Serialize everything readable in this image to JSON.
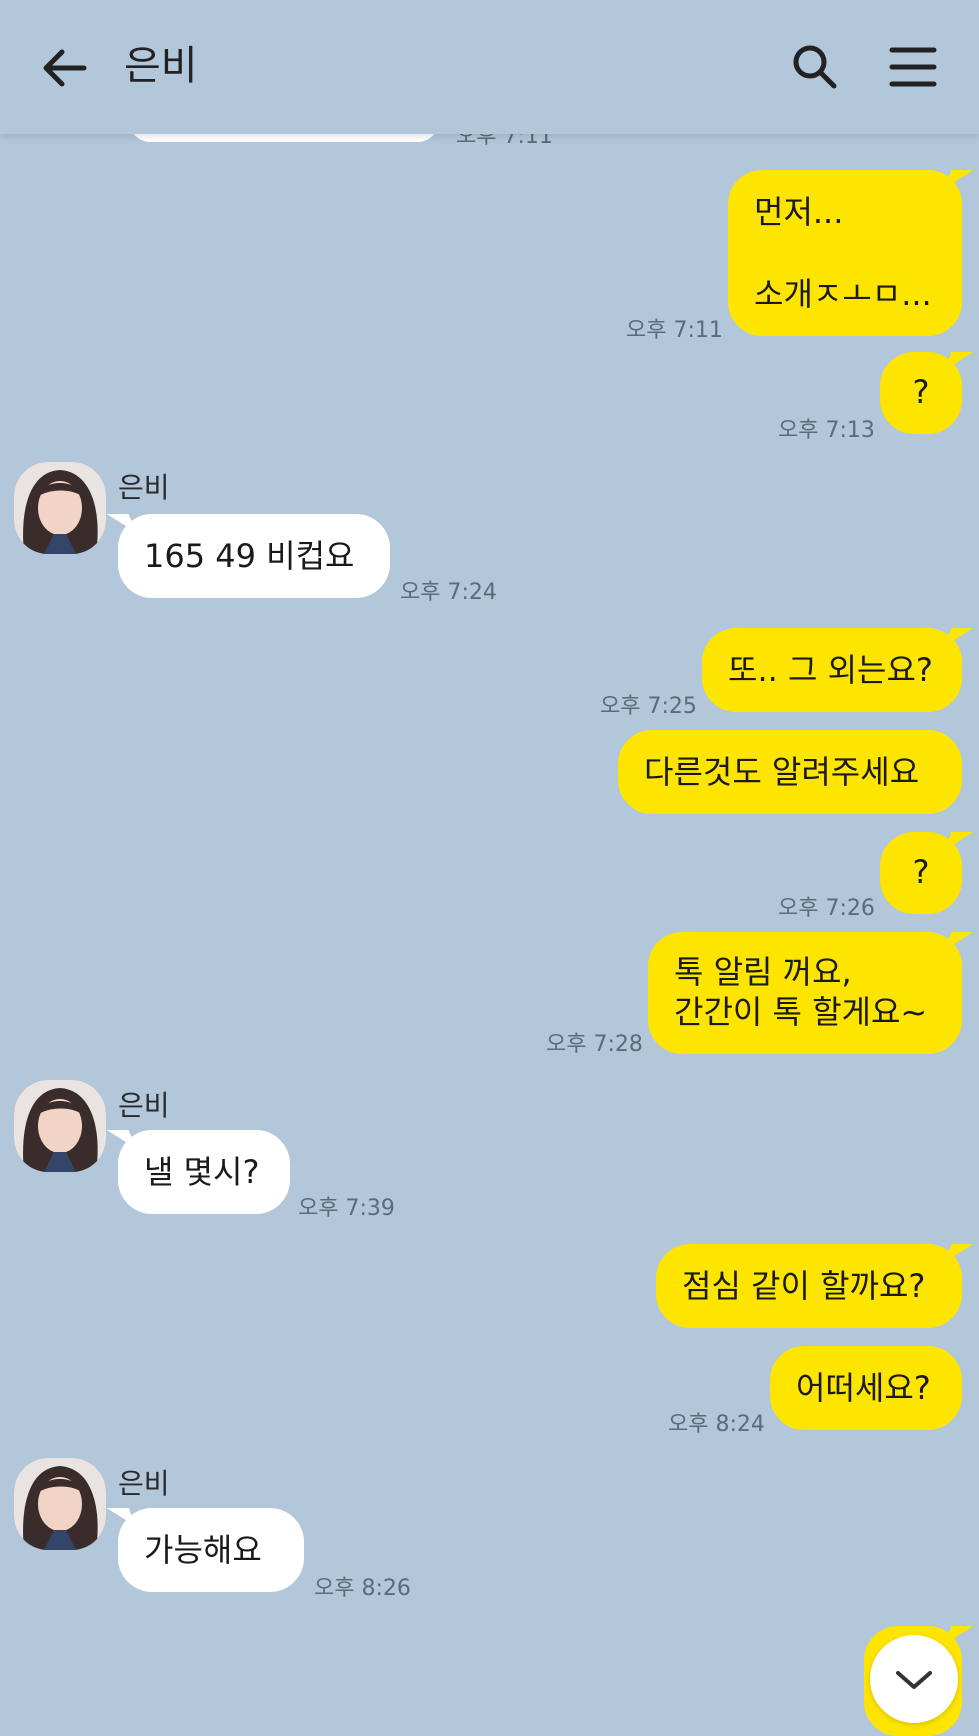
{
  "header": {
    "title": "은비"
  },
  "partial_top": {
    "time": "오후 7:11"
  },
  "messages": [
    {
      "line1": "먼저...",
      "line2": "소개ㅈㅗㅁ...",
      "time": "오후 7:11"
    },
    {
      "text": "?",
      "time": "오후 7:13"
    },
    {
      "sender": "은비",
      "text": "165 49 비컵요",
      "time": "오후 7:24"
    },
    {
      "text": "또.. 그 외는요?",
      "time": "오후 7:25"
    },
    {
      "text": "다른것도 알려주세요"
    },
    {
      "text": "?",
      "time": "오후 7:26"
    },
    {
      "line1": "톡 알림 꺼요,",
      "line2": "간간이 톡 할게요~",
      "time": "오후 7:28"
    },
    {
      "sender": "은비",
      "text": "낼 몇시?",
      "time": "오후 7:39"
    },
    {
      "text": "점심 같이 할까요?"
    },
    {
      "text": "어떠세요?",
      "time": "오후 8:24"
    },
    {
      "sender": "은비",
      "text": "가능해요",
      "time": "오후 8:26"
    }
  ],
  "icons": {
    "back": "arrow-left-icon",
    "search": "search-icon",
    "menu": "hamburger-menu-icon",
    "scroll": "chevron-down-icon"
  },
  "colors": {
    "background": "#b2c7da",
    "my_bubble": "#fee500",
    "their_bubble": "#ffffff"
  }
}
